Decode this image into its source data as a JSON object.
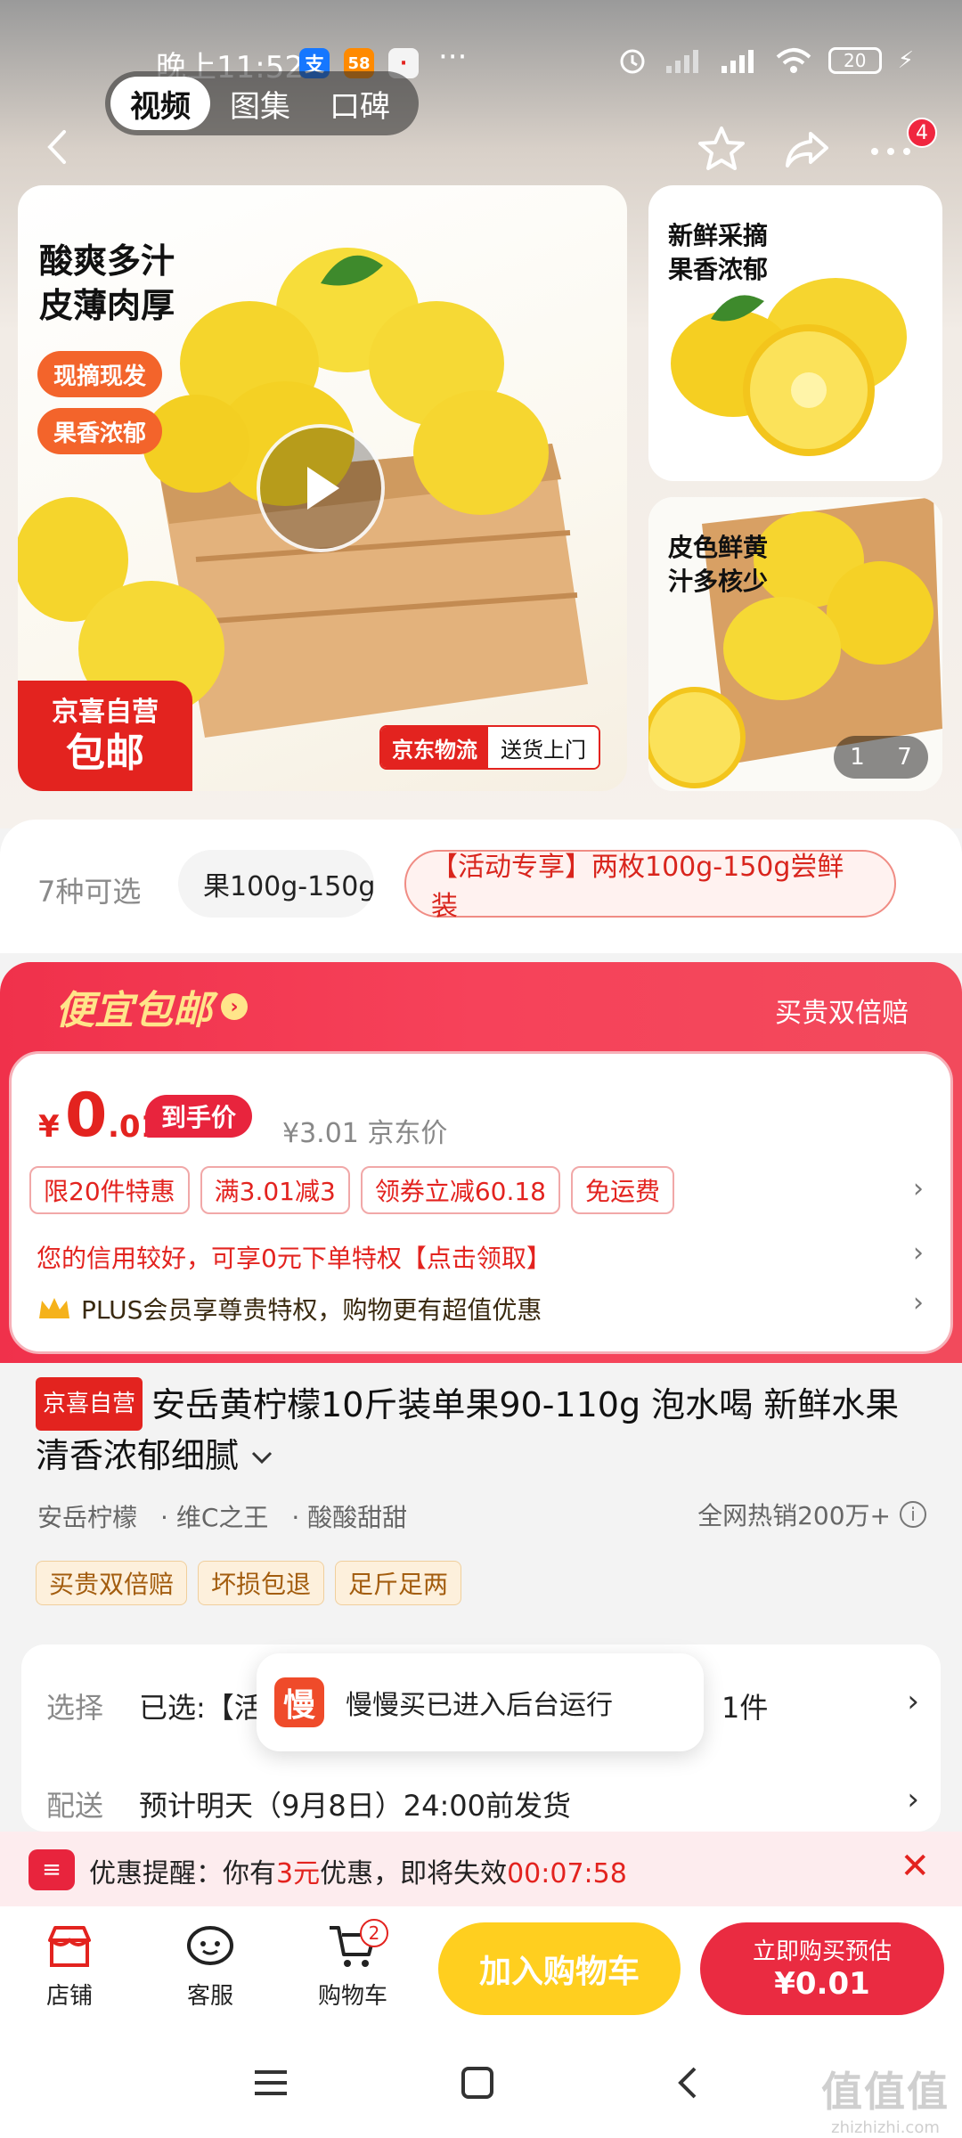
{
  "status_bar": {
    "time": "晚上11:52",
    "apps": [
      "支",
      "58",
      "·"
    ],
    "dots": "···",
    "battery": "20"
  },
  "media_tabs": [
    "视频",
    "图集",
    "口碑"
  ],
  "header": {
    "notification_count": "4"
  },
  "gallery": {
    "main": {
      "headline_1": "酸爽多汁",
      "headline_2": "皮薄肉厚",
      "pill_1": "现摘现发",
      "pill_2": "果香浓郁",
      "corner_1": "京喜自营",
      "corner_2": "包邮",
      "logistics_left": "京东物流",
      "logistics_right": "送货上门"
    },
    "side1": {
      "line_1": "新鲜采摘",
      "line_2": "果香浓郁"
    },
    "side2": {
      "line_1": "皮色鲜黄",
      "line_2": "汁多核少"
    },
    "page_current": "1",
    "page_total": "7"
  },
  "specs": {
    "count_label": "7种可选",
    "chip_1": "果100g-150g",
    "chip_2": "【活动专享】两枚100g-150g尝鲜装"
  },
  "price_panel": {
    "title": "便宜包邮",
    "right_label": "买贵双倍赔",
    "currency": "¥",
    "price_int": "0",
    "price_dec": ".01",
    "price_tag": "到手价",
    "original": "¥3.01 京东价",
    "coupons": [
      "限20件特惠",
      "满3.01减3",
      "领券立减60.18",
      "免运费"
    ],
    "credit_text": "您的信用较好，可享0元下单特权【点击领取】",
    "plus_text": "PLUS会员享尊贵特权，购物更有超值优惠"
  },
  "product": {
    "badge": "京喜自营",
    "title": "安岳黄柠檬10斤装单果90-110g 泡水喝 新鲜水果 清香浓郁细腻",
    "tags": [
      "安岳柠檬",
      "· 维C之王",
      "· 酸酸甜甜"
    ],
    "hot_sales": "全网热销200万+",
    "guarantees": [
      "买贵双倍赔",
      "坏损包退",
      "足斤足两"
    ]
  },
  "options": {
    "select_label": "选择",
    "select_value": "已选:【活",
    "select_suffix": "装，1件",
    "delivery_label": "配送",
    "delivery_value": "预计明天（9月8日）24:00前发货"
  },
  "toast": {
    "icon_text": "慢",
    "text": "慢慢买已进入后台运行"
  },
  "reminder": {
    "icon_text": "≡",
    "prefix": "优惠提醒：你有",
    "amount": "3元",
    "middle": "优惠，即将失效",
    "countdown": "00:07:58"
  },
  "bottom_bar": {
    "shop": "店铺",
    "service": "客服",
    "cart": "购物车",
    "cart_count": "2",
    "add_to_cart": "加入购物车",
    "buy_now": "立即购买预估",
    "buy_price": "¥0.01"
  },
  "watermark": {
    "main": "值值值",
    "sub": "zhizhizhi.com"
  },
  "colors": {
    "accent": "#e3231f",
    "buy": "#ea2b41",
    "cart": "#ffcf1f"
  }
}
